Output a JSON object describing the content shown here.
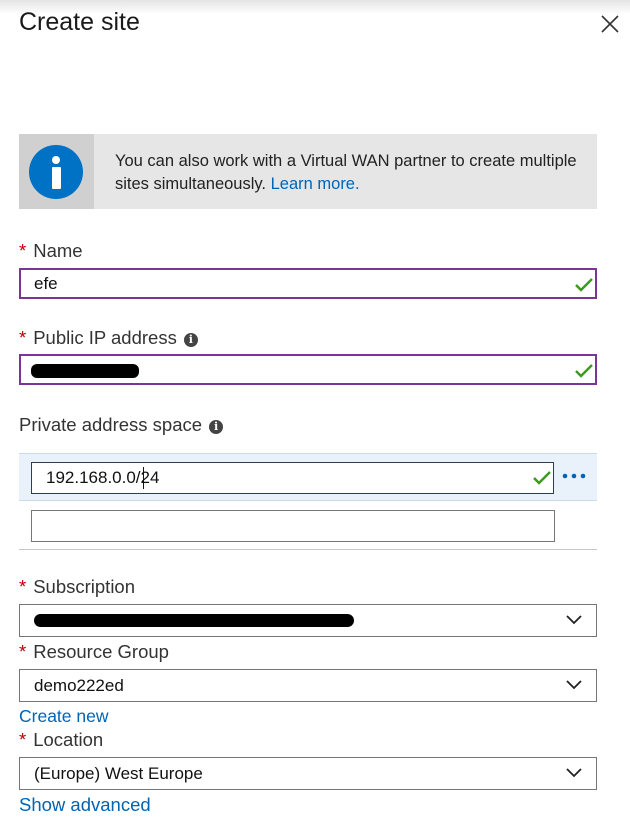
{
  "header": {
    "title": "Create site"
  },
  "info_banner": {
    "text": "You can also work with a Virtual WAN partner to create multiple sites simultaneously.",
    "link": "Learn more."
  },
  "form": {
    "name": {
      "label": "Name",
      "value": "efe",
      "valid": true
    },
    "public_ip": {
      "label": "Public IP address",
      "value_redacted": true,
      "valid": true
    },
    "private_address_space": {
      "label": "Private address space",
      "entries": [
        "192.168.0.0/24"
      ],
      "new_entry_value": ""
    },
    "subscription": {
      "label": "Subscription",
      "value_redacted": true
    },
    "resource_group": {
      "label": "Resource Group",
      "value": "demo222ed",
      "create_new": "Create new"
    },
    "location": {
      "label": "Location",
      "value": "(Europe) West Europe"
    },
    "show_advanced": "Show advanced"
  },
  "colors": {
    "accent": "#0064b4",
    "required": "#c00000",
    "focus_border": "#7a3597",
    "valid_check": "#3b9a1c",
    "info_icon": "#0072c6"
  },
  "icons": {
    "close": "close-icon",
    "info": "info-icon",
    "tooltip": "info-tooltip-icon",
    "check": "checkmark-icon",
    "more": "ellipsis-icon",
    "dropdown": "chevron-down-icon"
  }
}
